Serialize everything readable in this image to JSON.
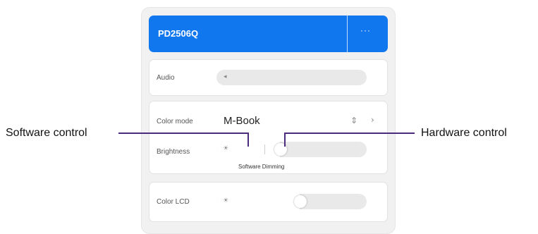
{
  "device": {
    "title": "PD2506Q",
    "more_label": "···"
  },
  "audio": {
    "label": "Audio",
    "icon": "speaker-icon"
  },
  "color_mode": {
    "label": "Color mode",
    "value": "M-Book",
    "stepper_icon": "up-down-chevron-icon",
    "next_icon": "chevron-right-icon"
  },
  "brightness": {
    "label": "Brightness",
    "icon": "sun-icon",
    "caption": "Software Dimming",
    "level_fraction": 0.3
  },
  "color_lcd": {
    "label": "Color LCD",
    "icon": "sun-icon",
    "level_fraction": 0.52
  },
  "callouts": {
    "left": "Software control",
    "right": "Hardware control"
  },
  "colors": {
    "accent": "#1177ee",
    "callout": "#4b2c7c",
    "panel": "#f1f1f1"
  }
}
